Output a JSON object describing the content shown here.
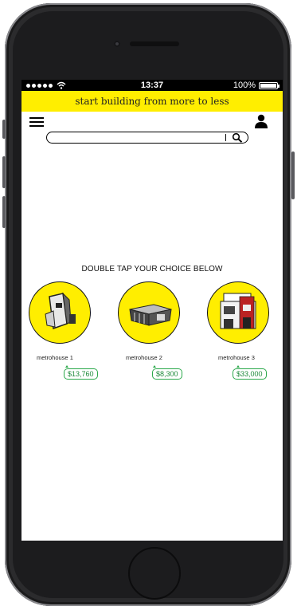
{
  "status_bar": {
    "time": "13:37",
    "battery_percent": "100%",
    "battery_level": 1.0,
    "signal_dots": 5
  },
  "banner": {
    "text": "start building from more to less",
    "color": "#ffee00"
  },
  "header": {
    "menu_icon": "hamburger-menu-icon",
    "user_icon": "user-profile-icon"
  },
  "search": {
    "value": "",
    "placeholder": "",
    "icon": "search-icon"
  },
  "prompt": "DOUBLE TAP YOUR CHOICE  BELOW",
  "choices": [
    {
      "name": "metrohouse 1",
      "price": "$13,760"
    },
    {
      "name": "metrohouse 2",
      "price": "$8,300"
    },
    {
      "name": "metrohouse 3",
      "price": "$33,000"
    }
  ],
  "colors": {
    "accent_yellow": "#ffee00",
    "price_green": "#2aa84a"
  }
}
